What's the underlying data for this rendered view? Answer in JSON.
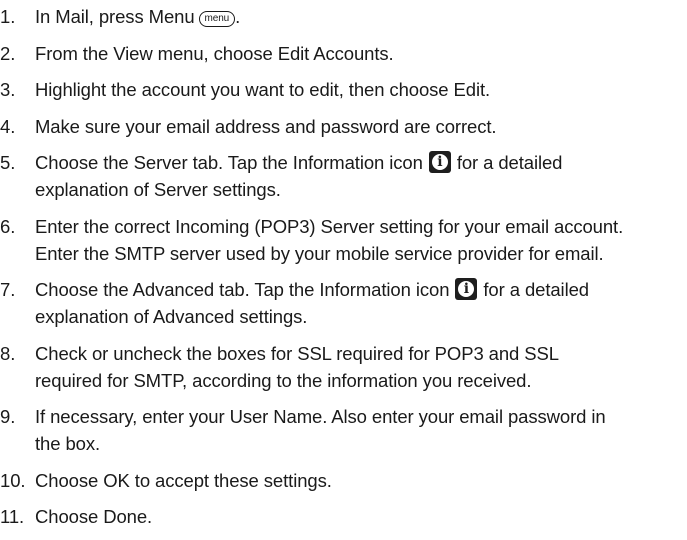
{
  "steps": [
    {
      "num": "1.",
      "pre": "In Mail, press Menu",
      "key": "menu",
      "post": "."
    },
    {
      "num": "2.",
      "text": "From the View menu, choose Edit Accounts."
    },
    {
      "num": "3.",
      "text": "Highlight the account you want to edit, then choose Edit."
    },
    {
      "num": "4.",
      "text": "Make sure your email address and password are correct."
    },
    {
      "num": "5.",
      "pre": "Choose the Server tab. Tap the Information icon",
      "post": "for a detailed",
      "line2": "explanation of Server settings."
    },
    {
      "num": "6.",
      "line1": "Enter the correct Incoming (POP3) Server setting for your email account.",
      "line2": "Enter the SMTP server used by your mobile service provider for email."
    },
    {
      "num": "7.",
      "pre": "Choose the Advanced tab. Tap the Information icon",
      "post": "for a detailed",
      "line2": "explanation of Advanced settings."
    },
    {
      "num": "8.",
      "line1": "Check or uncheck the boxes for SSL required for POP3 and SSL",
      "line2": "required for SMTP, according to the information you received."
    },
    {
      "num": "9.",
      "line1": "If necessary, enter your User Name. Also enter your email password in",
      "line2": "the box."
    },
    {
      "num": "10.",
      "text": "Choose OK to accept these settings."
    },
    {
      "num": "11.",
      "text": "Choose Done."
    }
  ]
}
